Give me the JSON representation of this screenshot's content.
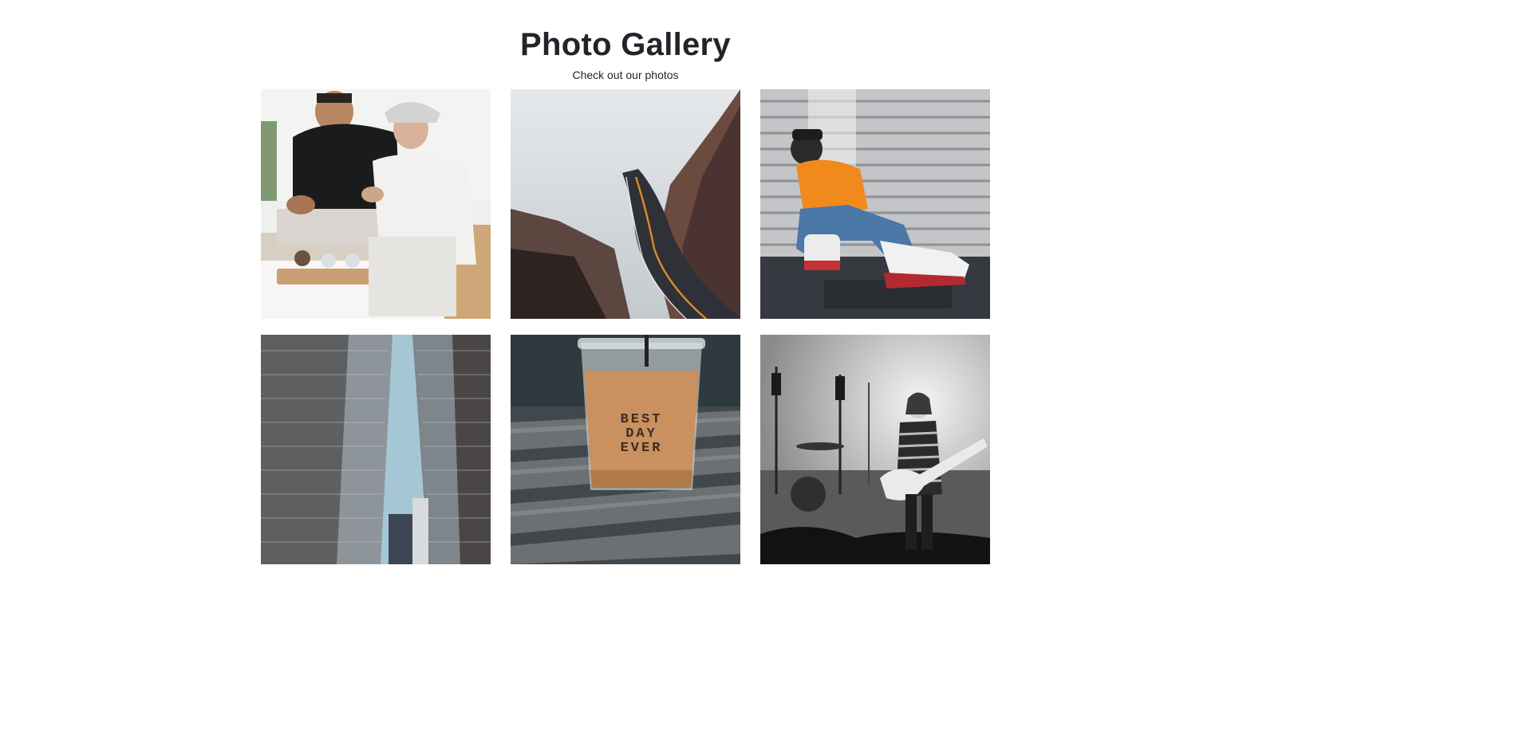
{
  "header": {
    "title": "Photo Gallery",
    "subtitle": "Check out our photos"
  },
  "gallery": {
    "photos": [
      {
        "subject": "friends-gaming",
        "colors": {
          "bg": "#e9ecea",
          "accent": "#1b1d1c",
          "secondary": "#f0eeec",
          "floor": "#dcd2c4"
        }
      },
      {
        "subject": "coastal-road",
        "colors": {
          "bg": "#dfe3e6",
          "accent": "#3a2c2a",
          "secondary": "#7a5347",
          "floor": "#2b2e33"
        }
      },
      {
        "subject": "person-orange-shirt",
        "colors": {
          "bg": "#b9bbbd",
          "accent": "#f08a1c",
          "secondary": "#4b78a8",
          "floor": "#3a3d42"
        }
      },
      {
        "subject": "skyscrapers",
        "colors": {
          "bg": "#6d7a84",
          "accent": "#2c2a29",
          "secondary": "#a4c6d6",
          "floor": "#d9d9d9"
        }
      },
      {
        "subject": "iced-coffee",
        "colors": {
          "bg": "#4b5257",
          "accent": "#c98d5f",
          "secondary": "#6a6c6d",
          "floor": "#8a8d8f"
        },
        "cup_text": [
          "BEST",
          "DAY",
          "EVER"
        ]
      },
      {
        "subject": "guitarist-concert",
        "colors": {
          "bg": "#d5d5d5",
          "accent": "#1f1f1f",
          "secondary": "#9a9a9a",
          "floor": "#111111"
        }
      }
    ]
  }
}
